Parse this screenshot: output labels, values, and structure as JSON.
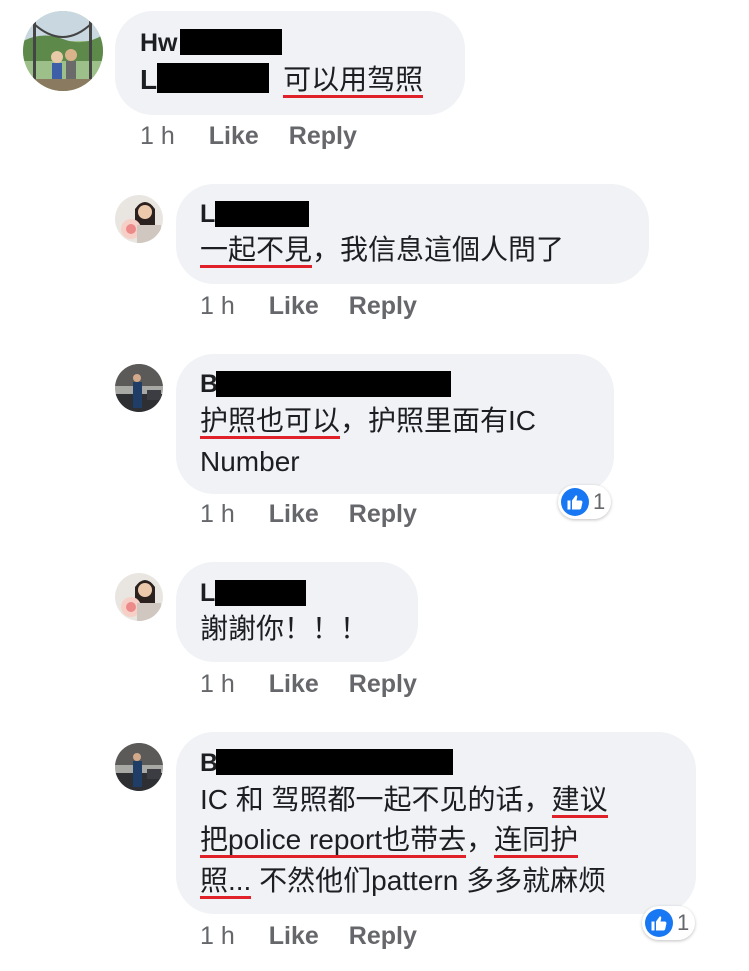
{
  "comments": [
    {
      "author_prefix": "Hw",
      "text_prefix": "L",
      "text": "可以用驾照",
      "time": "1 h",
      "like": "Like",
      "reply": "Reply"
    },
    {
      "author_prefix": "L",
      "text_underlined": "一起不見",
      "text_rest": "，我信息這個人問了",
      "time": "1 h",
      "like": "Like",
      "reply": "Reply"
    },
    {
      "author_prefix": "B",
      "text_underlined": "护照也可以",
      "text_rest": "，护照里面有IC",
      "text_line2": "Number",
      "reaction_count": "1",
      "time": "1 h",
      "like": "Like",
      "reply": "Reply"
    },
    {
      "author_prefix": "L",
      "text": "謝謝你！！！",
      "time": "1 h",
      "like": "Like",
      "reply": "Reply"
    },
    {
      "author_prefix": "B",
      "line1_plain": "IC 和 驾照都一起不见的话，",
      "line1_ul": "建议",
      "line2_ul": "把police report也带去",
      "line2_plain": "，",
      "line2_ul2": "连同护",
      "line3_ul": "照...",
      "line3_plain": " 不然他们pattern 多多就麻烦",
      "reaction_count": "1",
      "time": "1 h",
      "like": "Like",
      "reply": "Reply"
    }
  ],
  "colors": {
    "bubble": "#f0f2f5",
    "underline": "#e0212a",
    "like_blue": "#1877f2",
    "meta_gray": "#65676b"
  }
}
